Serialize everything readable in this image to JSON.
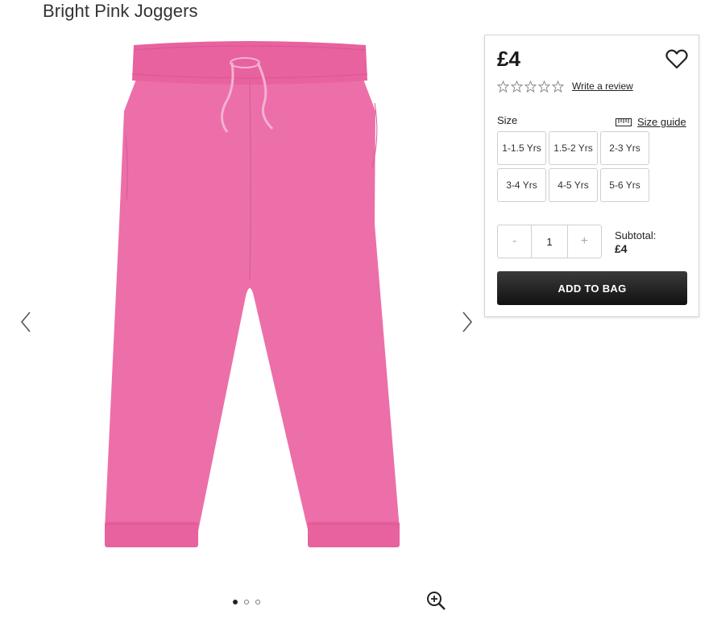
{
  "product": {
    "title": "Bright Pink Joggers",
    "price": "£4",
    "review_link": "Write a review",
    "rating_stars": 0,
    "rating_max": 5
  },
  "size_section": {
    "label": "Size",
    "guide_label": "Size guide",
    "options": [
      "1-1.5 Yrs",
      "1.5-2 Yrs",
      "2-3 Yrs",
      "3-4 Yrs",
      "4-5 Yrs",
      "5-6 Yrs"
    ]
  },
  "quantity": {
    "minus": "-",
    "value": "1",
    "plus": "+"
  },
  "subtotal": {
    "label": "Subtotal:",
    "amount": "£4"
  },
  "add_to_bag": "ADD TO BAG",
  "gallery": {
    "image_count": 3,
    "active_index": 0,
    "product_color": "#ec6fa9"
  },
  "icons": [
    "chevron-left-icon",
    "chevron-right-icon",
    "heart-icon",
    "star-icon",
    "ruler-icon",
    "zoom-in-icon"
  ]
}
